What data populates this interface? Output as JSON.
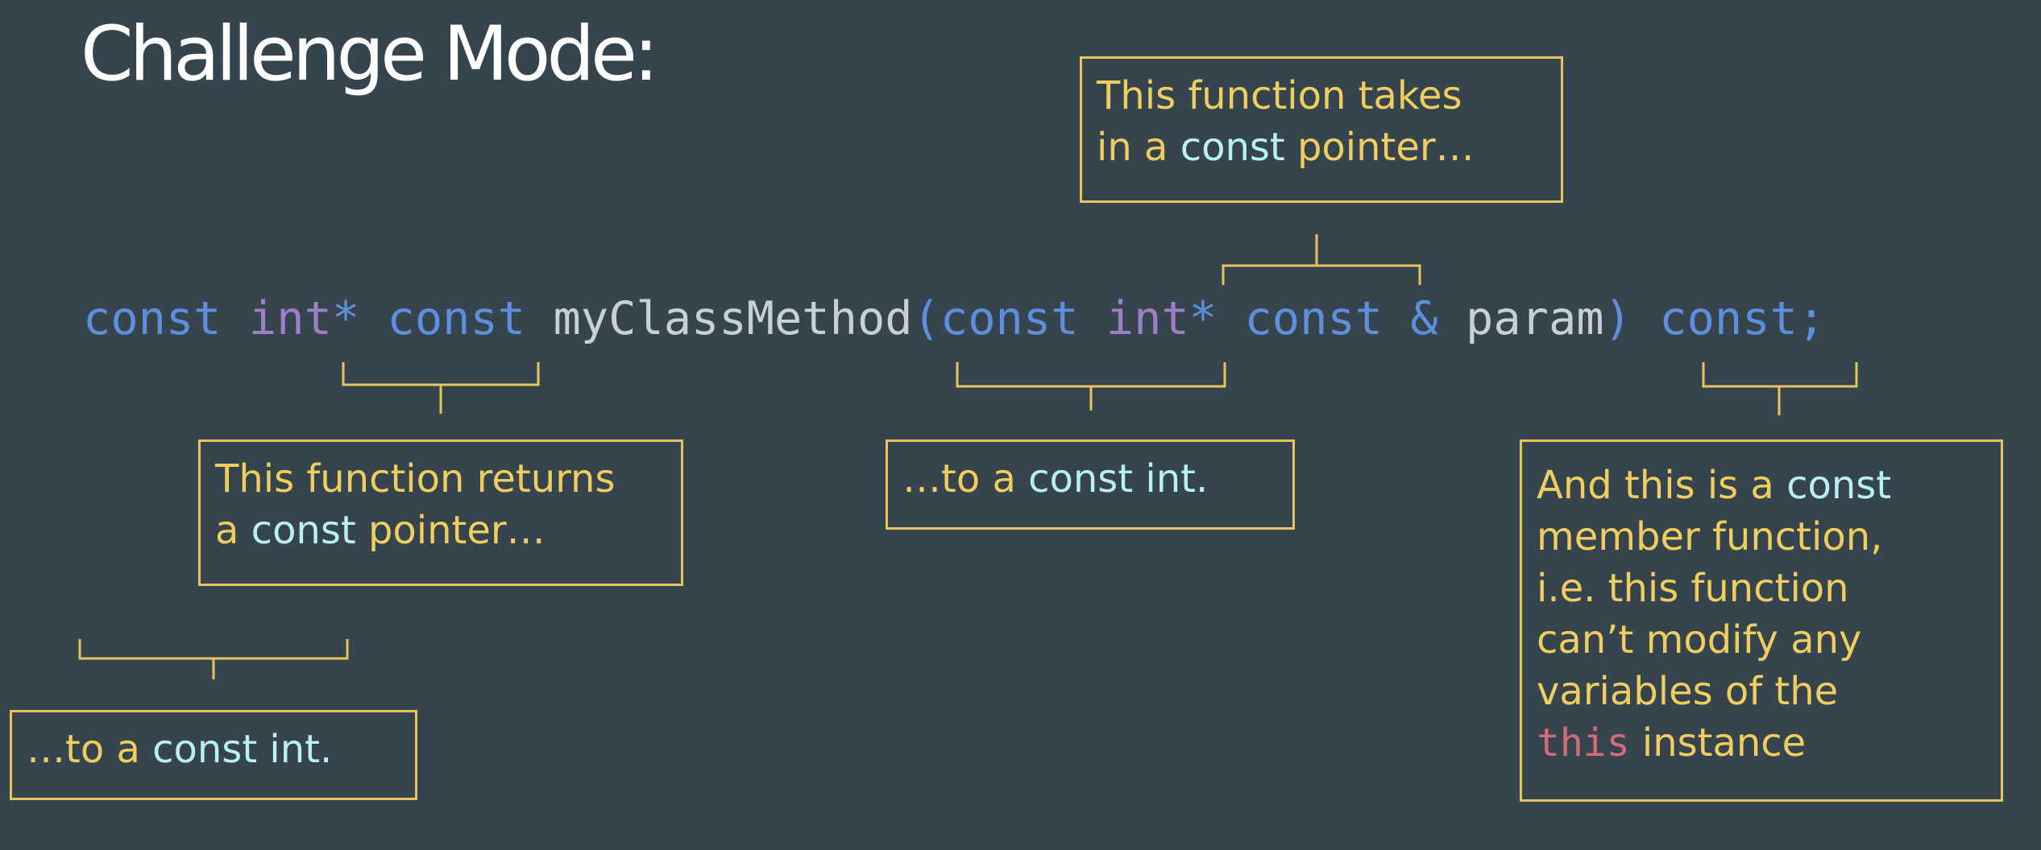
{
  "title": "Challenge Mode:",
  "code": {
    "tokens": [
      {
        "text": "const",
        "kind": "kw"
      },
      {
        "text": " ",
        "kind": "sp"
      },
      {
        "text": "int",
        "kind": "ty"
      },
      {
        "text": "*",
        "kind": "kw"
      },
      {
        "text": " ",
        "kind": "sp"
      },
      {
        "text": "const",
        "kind": "kw"
      },
      {
        "text": " ",
        "kind": "sp"
      },
      {
        "text": "myClassMethod",
        "kind": "id"
      },
      {
        "text": "(",
        "kind": "pn"
      },
      {
        "text": "const",
        "kind": "kw"
      },
      {
        "text": " ",
        "kind": "sp"
      },
      {
        "text": "int",
        "kind": "ty"
      },
      {
        "text": "*",
        "kind": "kw"
      },
      {
        "text": " ",
        "kind": "sp"
      },
      {
        "text": "const",
        "kind": "kw"
      },
      {
        "text": " ",
        "kind": "sp"
      },
      {
        "text": "&",
        "kind": "kw"
      },
      {
        "text": " ",
        "kind": "sp"
      },
      {
        "text": "param",
        "kind": "id"
      },
      {
        "text": ")",
        "kind": "pn"
      },
      {
        "text": " ",
        "kind": "sp"
      },
      {
        "text": "const",
        "kind": "kw"
      },
      {
        "text": ";",
        "kind": "kw"
      }
    ]
  },
  "annotations": {
    "takes_pointer": {
      "lines": [
        [
          {
            "text": "This function takes",
            "style": "plain"
          }
        ],
        [
          {
            "text": "in a ",
            "style": "plain"
          },
          {
            "text": "const",
            "style": "hl"
          },
          {
            "text": " pointer…",
            "style": "plain"
          }
        ]
      ]
    },
    "returns_pointer": {
      "lines": [
        [
          {
            "text": "This function returns",
            "style": "plain"
          }
        ],
        [
          {
            "text": "a ",
            "style": "plain"
          },
          {
            "text": "const",
            "style": "hl"
          },
          {
            "text": " pointer…",
            "style": "plain"
          }
        ]
      ]
    },
    "param_const_int": {
      "lines": [
        [
          {
            "text": "…to a ",
            "style": "plain"
          },
          {
            "text": "const int.",
            "style": "hl"
          }
        ]
      ]
    },
    "return_const_int": {
      "lines": [
        [
          {
            "text": "…to a ",
            "style": "plain"
          },
          {
            "text": "const int.",
            "style": "hl"
          }
        ]
      ]
    },
    "const_member": {
      "lines": [
        [
          {
            "text": "And this is a ",
            "style": "plain"
          },
          {
            "text": "const",
            "style": "hl"
          }
        ],
        [
          {
            "text": "member function,",
            "style": "plain"
          }
        ],
        [
          {
            "text": "i.e. this function",
            "style": "plain"
          }
        ],
        [
          {
            "text": "can’t modify any",
            "style": "plain"
          }
        ],
        [
          {
            "text": "variables of the",
            "style": "plain"
          }
        ],
        [
          {
            "text": "this",
            "style": "mono"
          },
          {
            "text": " instance",
            "style": "plain"
          }
        ]
      ]
    }
  },
  "colors": {
    "background": "#36444e",
    "keyword": "#5e8fdc",
    "type": "#9d7fc6",
    "identifier": "#c9cfd6",
    "annotation_text": "#efcd5f",
    "annotation_highlight": "#b8f0f3",
    "this_keyword": "#d76a78",
    "bracket": "#e6c35b"
  }
}
